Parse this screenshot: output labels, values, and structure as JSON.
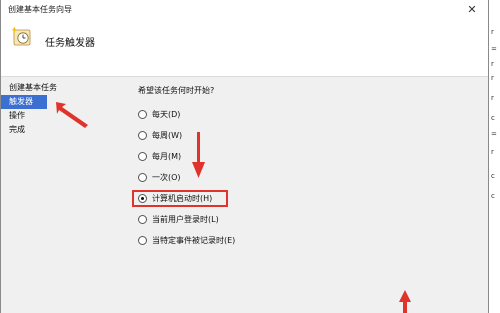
{
  "window": {
    "title": "创建基本任务向导",
    "close_glyph": "✕"
  },
  "header": {
    "title": "任务触发器",
    "icon": "clock-task-icon"
  },
  "sidebar": {
    "items": [
      {
        "label": "创建基本任务",
        "active": false
      },
      {
        "label": "触发器",
        "active": true
      },
      {
        "label": "操作",
        "active": false
      },
      {
        "label": "完成",
        "active": false
      }
    ]
  },
  "trigger": {
    "prompt": "希望该任务何时开始?",
    "options": [
      {
        "label": "每天(D)",
        "checked": false
      },
      {
        "label": "每周(W)",
        "checked": false
      },
      {
        "label": "每月(M)",
        "checked": false
      },
      {
        "label": "一次(O)",
        "checked": false
      },
      {
        "label": "计算机启动时(H)",
        "checked": true
      },
      {
        "label": "当前用户登录时(L)",
        "checked": false
      },
      {
        "label": "当特定事件被记录时(E)",
        "checked": false
      }
    ]
  },
  "background_window": {
    "fragments": [
      "r",
      "=",
      "r",
      "r",
      "r",
      "c",
      "=",
      "r",
      "c",
      "c"
    ]
  },
  "colors": {
    "accent": "#3b6fd1",
    "annotation_red": "#e0332b",
    "content_bg": "#f0f0f0"
  }
}
